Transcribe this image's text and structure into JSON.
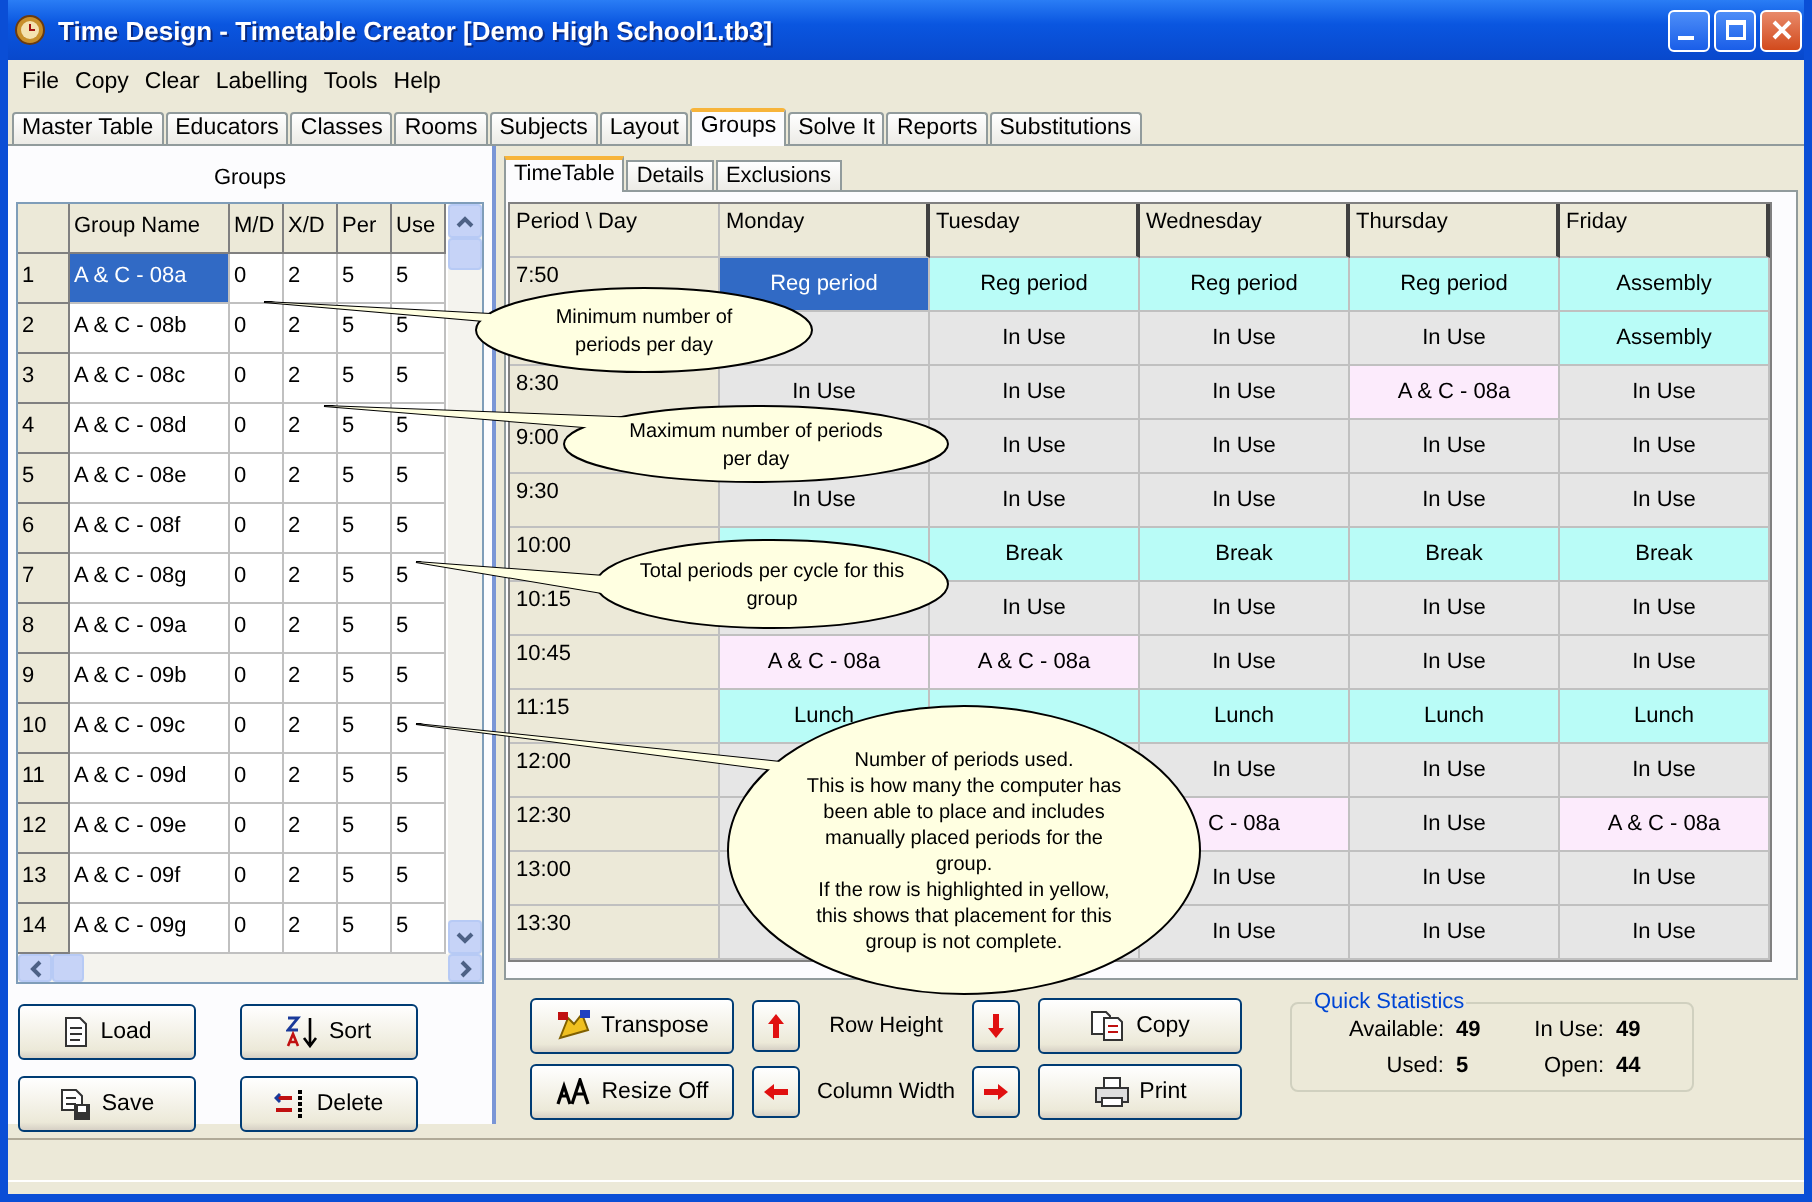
{
  "window": {
    "title": "Time Design - Timetable Creator [Demo High School1.tb3]"
  },
  "menu": [
    "File",
    "Copy",
    "Clear",
    "Labelling",
    "Tools",
    "Help"
  ],
  "tabs": [
    {
      "label": "Master Table",
      "selected": false
    },
    {
      "label": "Educators",
      "selected": false
    },
    {
      "label": "Classes",
      "selected": false
    },
    {
      "label": "Rooms",
      "selected": false
    },
    {
      "label": "Subjects",
      "selected": false
    },
    {
      "label": "Layout",
      "selected": false
    },
    {
      "label": "Groups",
      "selected": true
    },
    {
      "label": "Solve It",
      "selected": false
    },
    {
      "label": "Reports",
      "selected": false
    },
    {
      "label": "Substitutions",
      "selected": false
    }
  ],
  "groups_panel": {
    "title": "Groups",
    "columns": [
      "Group Name",
      "M/D",
      "X/D",
      "Per",
      "Use"
    ],
    "rows": [
      {
        "number": "1",
        "name": "A & C - 08a",
        "min": "0",
        "max": "2",
        "per": "5",
        "used": "5",
        "selected": true
      },
      {
        "number": "2",
        "name": "A & C - 08b",
        "min": "0",
        "max": "2",
        "per": "5",
        "used": "5",
        "selected": false
      },
      {
        "number": "3",
        "name": "A & C - 08c",
        "min": "0",
        "max": "2",
        "per": "5",
        "used": "5",
        "selected": false
      },
      {
        "number": "4",
        "name": "A & C - 08d",
        "min": "0",
        "max": "2",
        "per": "5",
        "used": "5",
        "selected": false
      },
      {
        "number": "5",
        "name": "A & C - 08e",
        "min": "0",
        "max": "2",
        "per": "5",
        "used": "5",
        "selected": false
      },
      {
        "number": "6",
        "name": "A & C - 08f",
        "min": "0",
        "max": "2",
        "per": "5",
        "used": "5",
        "selected": false
      },
      {
        "number": "7",
        "name": "A & C - 08g",
        "min": "0",
        "max": "2",
        "per": "5",
        "used": "5",
        "selected": false
      },
      {
        "number": "8",
        "name": "A & C - 09a",
        "min": "0",
        "max": "2",
        "per": "5",
        "used": "5",
        "selected": false
      },
      {
        "number": "9",
        "name": "A & C - 09b",
        "min": "0",
        "max": "2",
        "per": "5",
        "used": "5",
        "selected": false
      },
      {
        "number": "10",
        "name": "A & C - 09c",
        "min": "0",
        "max": "2",
        "per": "5",
        "used": "5",
        "selected": false
      },
      {
        "number": "11",
        "name": "A & C - 09d",
        "min": "0",
        "max": "2",
        "per": "5",
        "used": "5",
        "selected": false
      },
      {
        "number": "12",
        "name": "A & C - 09e",
        "min": "0",
        "max": "2",
        "per": "5",
        "used": "5",
        "selected": false
      },
      {
        "number": "13",
        "name": "A & C - 09f",
        "min": "0",
        "max": "2",
        "per": "5",
        "used": "5",
        "selected": false
      },
      {
        "number": "14",
        "name": "A & C - 09g",
        "min": "0",
        "max": "2",
        "per": "5",
        "used": "5",
        "selected": false
      }
    ],
    "buttons": [
      "Load",
      "Sort",
      "Save",
      "Delete"
    ]
  },
  "inner_tabs": [
    {
      "label": "TimeTable",
      "selected": true
    },
    {
      "label": "Details",
      "selected": false
    },
    {
      "label": "Exclusions",
      "selected": false
    }
  ],
  "timetable": {
    "corner": "Period \\ Day",
    "days": [
      "Monday",
      "Tuesday",
      "Wednesday",
      "Thursday",
      "Friday"
    ],
    "rows": [
      {
        "time": "7:50",
        "cells": [
          {
            "text": "Reg period",
            "kind": "fixed",
            "selected": true
          },
          {
            "text": "Reg period",
            "kind": "fixed",
            "selected": false
          },
          {
            "text": "Reg period",
            "kind": "fixed",
            "selected": false
          },
          {
            "text": "Reg period",
            "kind": "fixed",
            "selected": false
          },
          {
            "text": "Assembly",
            "kind": "fixed",
            "selected": false
          }
        ]
      },
      {
        "cells": [
          {
            "kind": "in_use"
          },
          {
            "text": "In Use",
            "kind": "in_use",
            "selected": false
          },
          {
            "text": "In Use",
            "kind": "in_use",
            "selected": false
          },
          {
            "text": "In Use",
            "kind": "in_use",
            "selected": false
          },
          {
            "text": "Assembly",
            "kind": "fixed",
            "selected": false
          }
        ]
      },
      {
        "time": "8:30",
        "cells": [
          {
            "text": "In Use",
            "kind": "in_use",
            "selected": false
          },
          {
            "text": "In Use",
            "kind": "in_use",
            "selected": false
          },
          {
            "text": "In Use",
            "kind": "in_use",
            "selected": false
          },
          {
            "text": "A & C - 08a",
            "kind": "group",
            "selected": false
          },
          {
            "text": "In Use",
            "kind": "in_use",
            "selected": false
          }
        ]
      },
      {
        "time": "9:00",
        "cells": [
          {
            "kind": "in_use"
          },
          {
            "text": "In Use",
            "kind": "in_use",
            "selected": false
          },
          {
            "text": "In Use",
            "kind": "in_use",
            "selected": false
          },
          {
            "text": "In Use",
            "kind": "in_use",
            "selected": false
          },
          {
            "text": "In Use",
            "kind": "in_use",
            "selected": false
          }
        ]
      },
      {
        "time": "9:30",
        "cells": [
          {
            "text": "In Use",
            "kind": "in_use",
            "selected": false
          },
          {
            "text": "In Use",
            "kind": "in_use",
            "selected": false
          },
          {
            "text": "In Use",
            "kind": "in_use",
            "selected": false
          },
          {
            "text": "In Use",
            "kind": "in_use",
            "selected": false
          },
          {
            "text": "In Use",
            "kind": "in_use",
            "selected": false
          }
        ]
      },
      {
        "time": "10:00",
        "cells": [
          {
            "kind": "fixed"
          },
          {
            "text": "Break",
            "kind": "fixed",
            "selected": false
          },
          {
            "text": "Break",
            "kind": "fixed",
            "selected": false
          },
          {
            "text": "Break",
            "kind": "fixed",
            "selected": false
          },
          {
            "text": "Break",
            "kind": "fixed",
            "selected": false
          }
        ]
      },
      {
        "time": "10:15",
        "cells": [
          {
            "kind": "in_use"
          },
          {
            "text": "In Use",
            "kind": "in_use",
            "selected": false
          },
          {
            "text": "In Use",
            "kind": "in_use",
            "selected": false
          },
          {
            "text": "In Use",
            "kind": "in_use",
            "selected": false
          },
          {
            "text": "In Use",
            "kind": "in_use",
            "selected": false
          }
        ]
      },
      {
        "time": "10:45",
        "cells": [
          {
            "text": "A & C - 08a",
            "kind": "group",
            "selected": false
          },
          {
            "text": "A & C - 08a",
            "kind": "group",
            "selected": false
          },
          {
            "text": "In Use",
            "kind": "in_use",
            "selected": false
          },
          {
            "text": "In Use",
            "kind": "in_use",
            "selected": false
          },
          {
            "text": "In Use",
            "kind": "in_use",
            "selected": false
          }
        ]
      },
      {
        "time": "11:15",
        "cells": [
          {
            "text": "Lunch",
            "kind": "fixed",
            "selected": false
          },
          {
            "kind": "fixed"
          },
          {
            "text": "Lunch",
            "kind": "fixed",
            "selected": false
          },
          {
            "text": "Lunch",
            "kind": "fixed",
            "selected": false
          },
          {
            "text": "Lunch",
            "kind": "fixed",
            "selected": false
          }
        ]
      },
      {
        "time": "12:00",
        "cells": [
          {
            "kind": "in_use"
          },
          {
            "kind": "in_use"
          },
          {
            "text": "In Use",
            "kind": "in_use",
            "selected": false
          },
          {
            "text": "In Use",
            "kind": "in_use",
            "selected": false
          },
          {
            "text": "In Use",
            "kind": "in_use",
            "selected": false
          }
        ]
      },
      {
        "time": "12:30",
        "cells": [
          {
            "kind": "in_use"
          },
          null,
          {
            "text": "C - 08a",
            "kind": "group",
            "selected": false
          },
          {
            "text": "In Use",
            "kind": "in_use",
            "selected": false
          },
          {
            "text": "A & C - 08a",
            "kind": "group",
            "selected": false
          }
        ]
      },
      {
        "time": "13:00",
        "cells": [
          {
            "kind": "in_use"
          },
          null,
          {
            "text": "In Use",
            "kind": "in_use",
            "selected": false
          },
          {
            "text": "In Use",
            "kind": "in_use",
            "selected": false
          },
          {
            "text": "In Use",
            "kind": "in_use",
            "selected": false
          }
        ]
      },
      {
        "time": "13:30",
        "cells": [
          {
            "kind": "in_use"
          },
          {
            "kind": "in_use"
          },
          {
            "text": "In Use",
            "kind": "in_use",
            "selected": false
          },
          {
            "text": "In Use",
            "kind": "in_use",
            "selected": false
          },
          {
            "text": "In Use",
            "kind": "in_use",
            "selected": false
          }
        ]
      }
    ]
  },
  "controls": {
    "buttons": [
      "Transpose",
      "Resize Off",
      "Copy",
      "Print"
    ],
    "row_height_label": "Row Height",
    "column_width_label": "Column Width"
  },
  "quick_statistics": {
    "title": "Quick Statistics",
    "items": [
      {
        "label": "Available:",
        "value": "49"
      },
      {
        "label": "In Use:",
        "value": "49"
      },
      {
        "label": "Used:",
        "value": "5"
      },
      {
        "label": "Open:",
        "value": "44"
      }
    ]
  },
  "callouts": [
    {
      "lines": [
        "Minimum number of",
        "periods per day"
      ]
    },
    {
      "lines": [
        "Maximum number of periods",
        "per day"
      ]
    },
    {
      "lines": [
        "Total periods per cycle for this",
        "group"
      ]
    },
    {
      "lines": [
        "Number of periods used.",
        "This is how many the computer has",
        "been able to place and includes",
        "manually placed periods for the",
        "group.",
        "If the row is highlighted in yellow,",
        "this shows that placement for this",
        "group is not complete."
      ]
    }
  ]
}
